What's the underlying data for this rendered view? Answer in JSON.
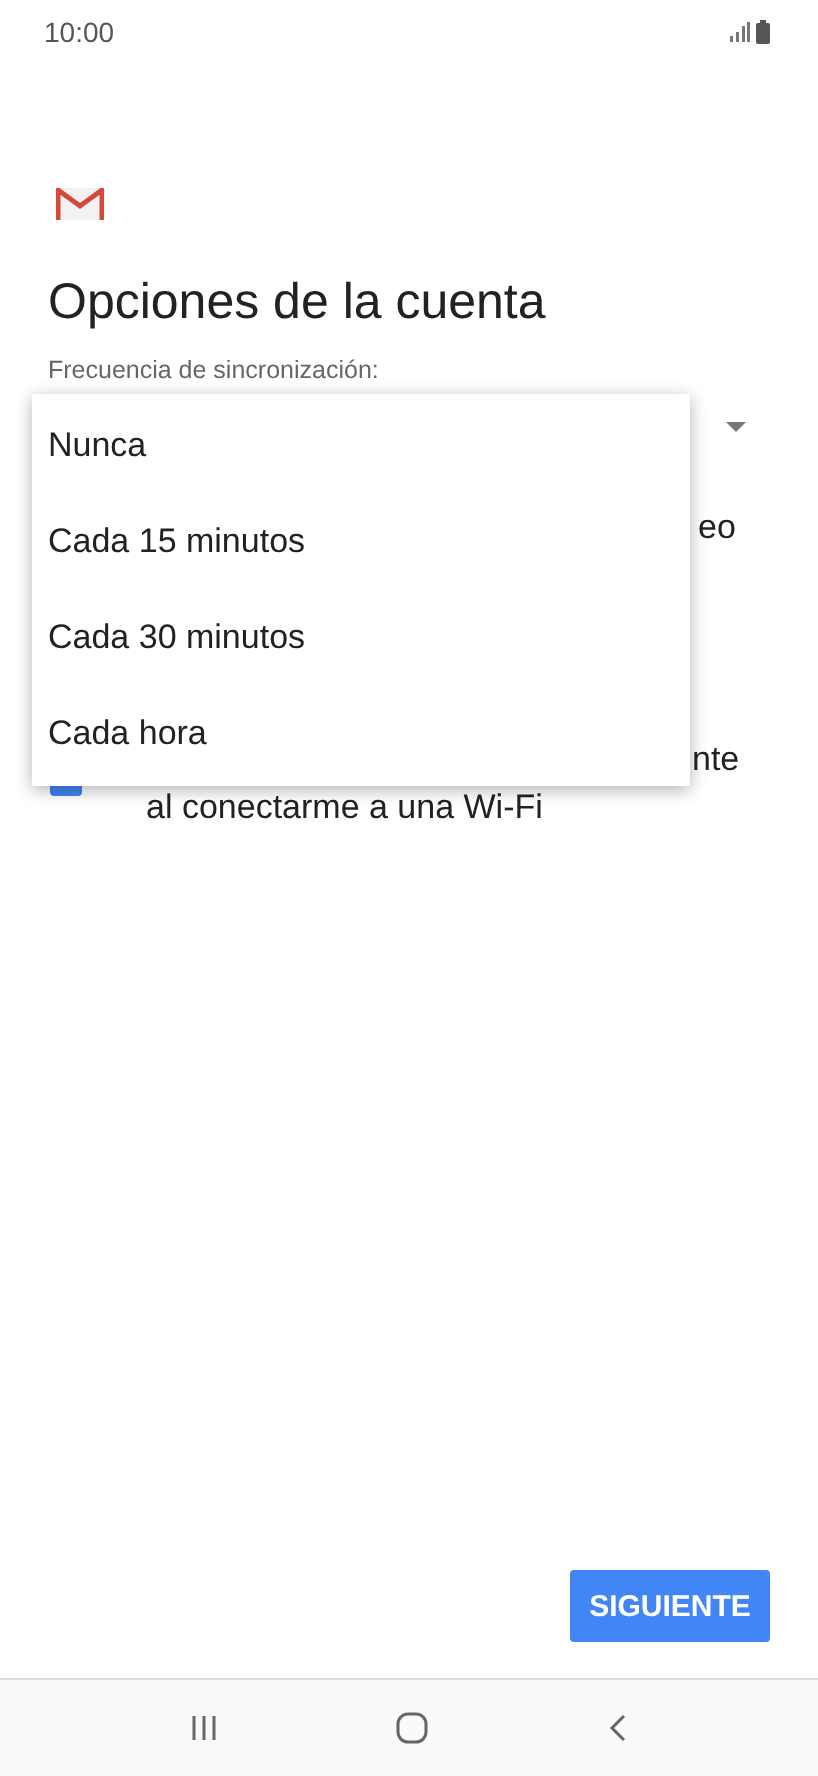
{
  "status_bar": {
    "time": "10:00"
  },
  "title": "Opciones de la cuenta",
  "sync_label": "Frecuencia de sincronización:",
  "behind": {
    "row_1_tail": "eo",
    "row_2_tail": "nte",
    "row_2_line_2": "al conectarme a una Wi-Fi",
    "row_2_checked": true
  },
  "menu": [
    {
      "label": "Nunca"
    },
    {
      "label": "Cada 15 minutos"
    },
    {
      "label": "Cada 30 minutos"
    },
    {
      "label": "Cada hora"
    }
  ],
  "next_button": "SIGUIENTE"
}
